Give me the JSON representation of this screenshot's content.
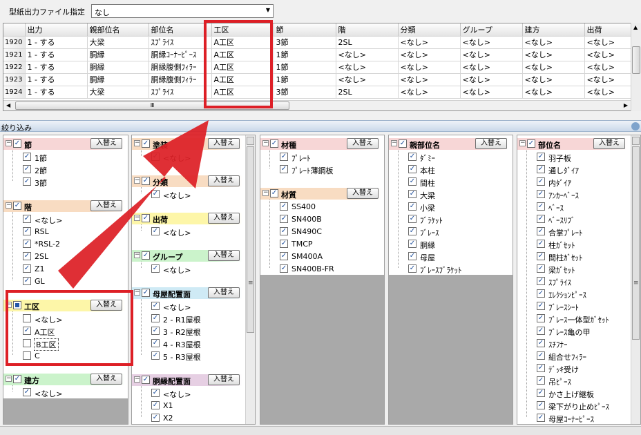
{
  "template_label": "型紙出力ファイル指定",
  "template_value": "なし",
  "grid": {
    "columns": [
      "出力",
      "親部位名",
      "部位名",
      "工区",
      "節",
      "階",
      "分類",
      "グループ",
      "建方",
      "出荷"
    ],
    "rows": [
      {
        "id": "1920",
        "cells": [
          "1 - する",
          "大梁",
          "ｽﾌﾟﾗｲｽ",
          "A工区",
          "3節",
          "2SL",
          "<なし>",
          "<なし>",
          "<なし>",
          "<なし>"
        ]
      },
      {
        "id": "1921",
        "cells": [
          "1 - する",
          "胴縁",
          "胴縁ｺｰﾅｰﾋﾟｰｽ",
          "A工区",
          "1節",
          "<なし>",
          "<なし>",
          "<なし>",
          "<なし>",
          "<なし>"
        ]
      },
      {
        "id": "1922",
        "cells": [
          "1 - する",
          "胴縁",
          "胴縁腹側ﾌｨﾗｰ",
          "A工区",
          "1節",
          "<なし>",
          "<なし>",
          "<なし>",
          "<なし>",
          "<なし>"
        ]
      },
      {
        "id": "1923",
        "cells": [
          "1 - する",
          "胴縁",
          "胴縁腹側ﾌｨﾗｰ",
          "A工区",
          "1節",
          "<なし>",
          "<なし>",
          "<なし>",
          "<なし>",
          "<なし>"
        ]
      },
      {
        "id": "1924",
        "cells": [
          "1 - する",
          "大梁",
          "ｽﾌﾟﾗｲｽ",
          "A工区",
          "3節",
          "2SL",
          "<なし>",
          "<なし>",
          "<なし>",
          "<なし>"
        ]
      }
    ]
  },
  "filter_title": "絞り込み",
  "swap_label": "入替え",
  "scroll_grip": "Ⅲ",
  "col1": {
    "setsu": {
      "title": "節",
      "items": [
        "1節",
        "2節",
        "3節"
      ]
    },
    "kai": {
      "title": "階",
      "items": [
        "<なし>",
        "RSL",
        "*RSL-2",
        "2SL",
        "Z1",
        "GL"
      ]
    },
    "kouku": {
      "title": "工区",
      "items": [
        "<なし>",
        "A工区",
        "B工区",
        "C"
      ]
    },
    "tatekata": {
      "title": "建方",
      "items": [
        "<なし>"
      ]
    }
  },
  "col2": {
    "tosou": {
      "title": "塗装",
      "items": [
        "<なし>"
      ]
    },
    "bunrui": {
      "title": "分類",
      "items": [
        "<なし>"
      ]
    },
    "shukka": {
      "title": "出荷",
      "items": [
        "<なし>"
      ]
    },
    "group": {
      "title": "グループ",
      "items": [
        "<なし>"
      ]
    },
    "moya": {
      "title": "母屋配置面",
      "items": [
        "<なし>",
        "2 - R1屋根",
        "3 - R2屋根",
        "4 - R3屋根",
        "5 - R3屋根"
      ]
    },
    "doubuchi": {
      "title": "胴縁配置面",
      "items": [
        "<なし>",
        "X1",
        "X2"
      ]
    }
  },
  "col3": {
    "zaishu": {
      "title": "材種",
      "items": [
        "ﾌﾟﾚｰﾄ",
        "ﾌﾟﾚｰﾄ薄鋼板"
      ]
    },
    "zaishitsu": {
      "title": "材質",
      "items": [
        "SS400",
        "SN400B",
        "SN490C",
        "TMCP",
        "SM400A",
        "SN400B-FR"
      ]
    }
  },
  "col4": {
    "oya": {
      "title": "親部位名",
      "items": [
        "ﾀﾞﾐｰ",
        "本柱",
        "間柱",
        "大梁",
        "小梁",
        "ﾌﾞﾗｹｯﾄ",
        "ﾌﾞﾚｰｽ",
        "胴縁",
        "母屋",
        "ﾌﾞﾚｰｽﾌﾞﾗｹｯﾄ"
      ]
    }
  },
  "col5": {
    "bui": {
      "title": "部位名",
      "items": [
        "羽子板",
        "通しﾀﾞｲｱ",
        "内ﾀﾞｲｱ",
        "ｱﾝｶｰﾍﾞｰｽ",
        "ﾍﾞｰｽ",
        "ﾍﾞｰｽﾘﾌﾞ",
        "合掌ﾌﾟﾚｰﾄ",
        "柱ｶﾞｾｯﾄ",
        "間柱ｶﾞｾｯﾄ",
        "梁ｶﾞｾｯﾄ",
        "ｽﾌﾟﾗｲｽ",
        "ｴﾚｸｼｮﾝﾋﾟｰｽ",
        "ﾌﾞﾚｰｽｼｰﾄ",
        "ﾌﾞﾚｰｽ一体型ｶﾞｾｯﾄ",
        "ﾌﾞﾚｰｽ亀の甲",
        "ｽﾁﾌﾅｰ",
        "組合せﾌｨﾗｰ",
        "ﾃﾞｯｷ受け",
        "吊ﾋﾟｰｽ",
        "かさ上げ継板",
        "梁下がり止めﾋﾟｰｽ",
        "母屋ｺｰﾅｰﾋﾟｰｽ"
      ]
    }
  },
  "colors": {
    "accent_red": "#dd1f26",
    "header_blue": "#c9d8ea",
    "grey_fill": "#a9a9a9"
  }
}
